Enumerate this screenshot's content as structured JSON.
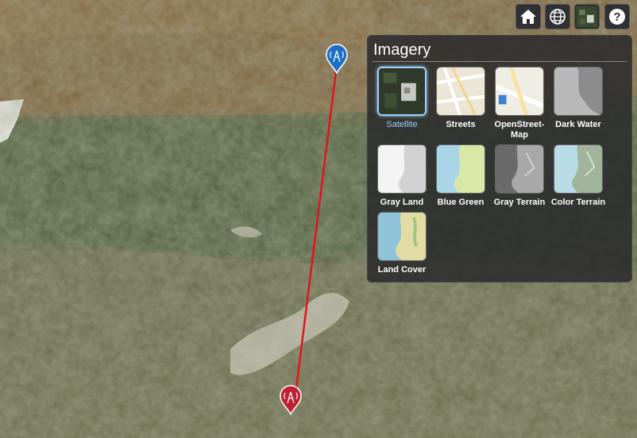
{
  "toolbar": {
    "home_icon": "home-icon",
    "globe_icon": "globe-icon",
    "layers_icon": "imagery-picker-icon",
    "help_icon": "help-icon"
  },
  "map": {
    "link_color": "#e0141e",
    "marker_top_color": "#1c6fc4",
    "marker_bottom_color": "#c02033"
  },
  "imagery_panel": {
    "title": "Imagery",
    "selected": "Satellite",
    "selected_color": "#9cd1ff",
    "options": [
      {
        "label": "Satellite"
      },
      {
        "label": "Streets"
      },
      {
        "label": "OpenStreet-Map"
      },
      {
        "label": "Dark Water"
      },
      {
        "label": "Gray Land"
      },
      {
        "label": "Blue Green"
      },
      {
        "label": "Gray Terrain"
      },
      {
        "label": "Color Terrain"
      },
      {
        "label": "Land Cover"
      }
    ]
  }
}
